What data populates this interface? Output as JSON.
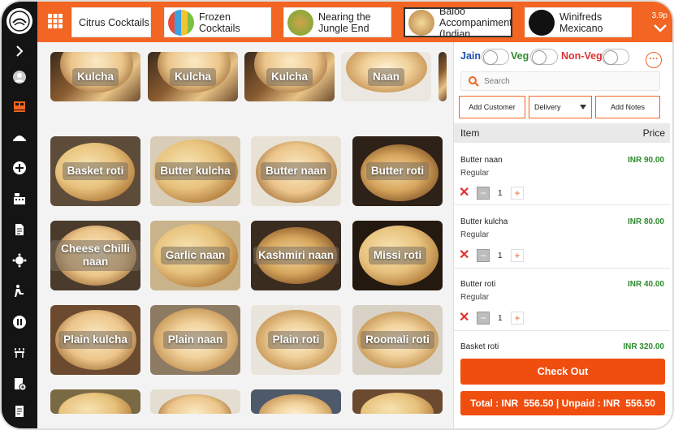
{
  "topbar": {
    "tabs": [
      {
        "label": "Citrus Cocktails",
        "thumb_color": "#ffffff"
      },
      {
        "label": "Frozen Cocktails",
        "thumb_color": "#e94b3c"
      },
      {
        "label": "Nearing the Jungle End",
        "thumb_color": "#8aa83a"
      },
      {
        "label": "Baloo Accompaniments (Indian",
        "thumb_color": "#c99b5c"
      },
      {
        "label": "Winifreds Mexicano",
        "thumb_color": "#111111"
      }
    ],
    "version": "3.9p"
  },
  "products": [
    {
      "label": "Kulcha"
    },
    {
      "label": "Kulcha"
    },
    {
      "label": "Kulcha"
    },
    {
      "label": "Naan"
    },
    {
      "label": "Basket roti"
    },
    {
      "label": "Butter kulcha"
    },
    {
      "label": "Butter naan"
    },
    {
      "label": "Butter roti"
    },
    {
      "label": "Cheese Chilli naan"
    },
    {
      "label": "Garlic naan"
    },
    {
      "label": "Kashmiri naan"
    },
    {
      "label": "Missi roti"
    },
    {
      "label": "Plain kulcha"
    },
    {
      "label": "Plain naan"
    },
    {
      "label": "Plain roti"
    },
    {
      "label": "Roomali roti"
    }
  ],
  "panel": {
    "filters": {
      "jain": "Jain",
      "veg": "Veg",
      "non_veg": "Non-Veg"
    },
    "search_placeholder": "Search",
    "buttons": {
      "add_customer": "Add Customer",
      "delivery": "Delivery",
      "add_notes": "Add Notes"
    },
    "header": {
      "item": "Item",
      "price": "Price"
    },
    "cart": [
      {
        "name": "Butter naan",
        "variant": "Regular",
        "price": "INR 90.00",
        "qty": "1"
      },
      {
        "name": "Butter kulcha",
        "variant": "Regular",
        "price": "INR 80.00",
        "qty": "1"
      },
      {
        "name": "Butter roti",
        "variant": "Regular",
        "price": "INR 40.00",
        "qty": "1"
      },
      {
        "name": "Basket roti",
        "variant": "",
        "price": "INR 320.00",
        "qty": ""
      }
    ],
    "checkout": "Check Out",
    "total": "Total : INR  556.50 | Unpaid : INR  556.50"
  },
  "colors": {
    "accent": "#f26522",
    "veg": "#2e8b2e",
    "jain": "#1f4fb5",
    "nonveg": "#d33"
  }
}
